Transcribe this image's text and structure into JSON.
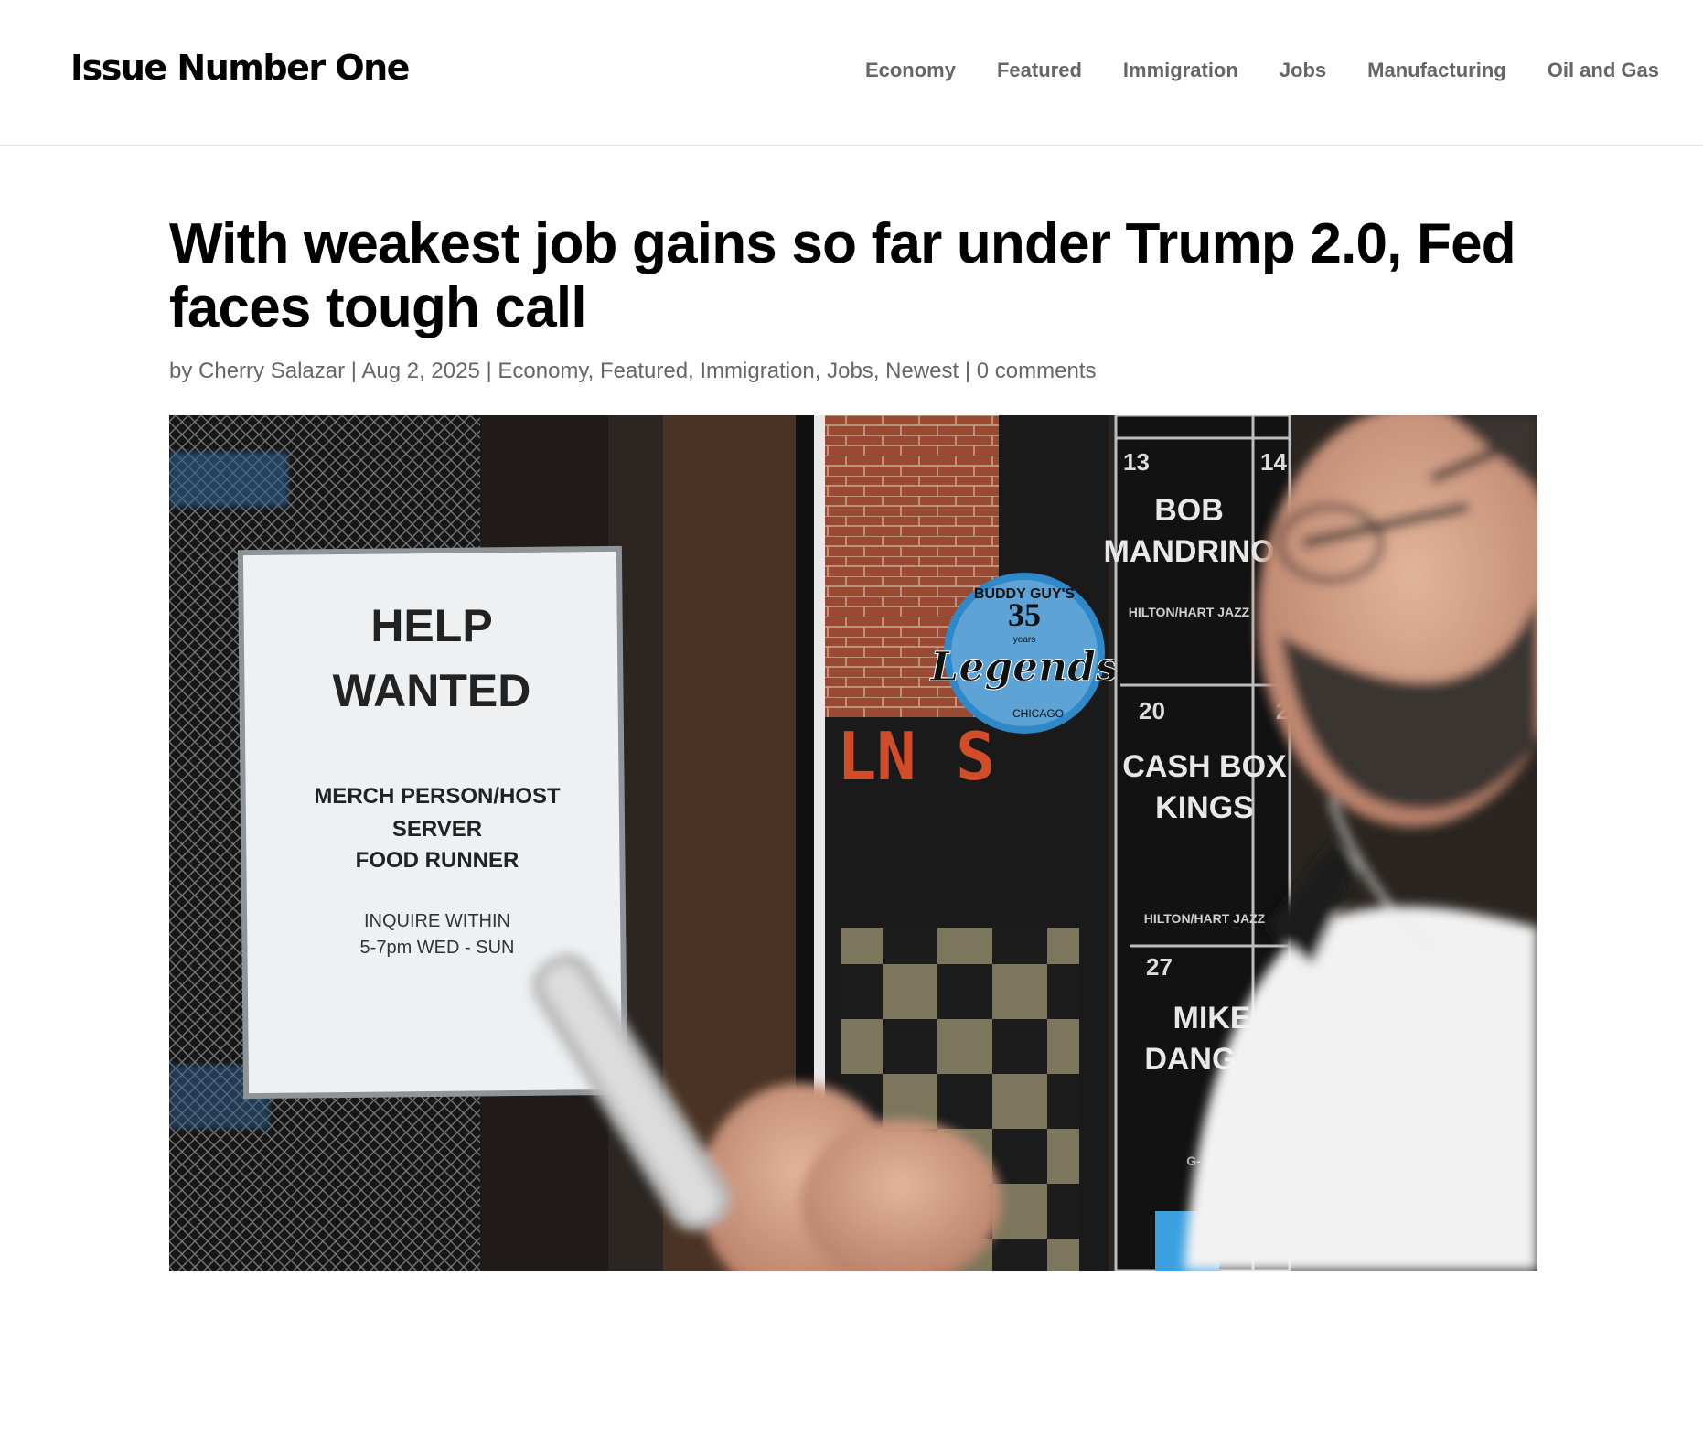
{
  "site": {
    "name": "Issue Number One"
  },
  "nav": {
    "items": [
      "Economy",
      "Featured",
      "Immigration",
      "Jobs",
      "Manufacturing",
      "Oil and Gas"
    ]
  },
  "article": {
    "title": "With weakest job gains so far under Trump 2.0, Fed faces tough call",
    "meta": {
      "by": "by",
      "author": "Cherry Salazar",
      "separator": "|",
      "date": "Aug 2, 2025",
      "categories": [
        "Economy",
        "Featured",
        "Immigration",
        "Jobs",
        "Newest"
      ],
      "comments": "0 comments"
    },
    "hero_image": {
      "sign": {
        "line1": "HELP",
        "line2": "WANTED",
        "positions": [
          "MERCH PERSON/HOST",
          "SERVER",
          "FOOD RUNNER"
        ],
        "inquire": "INQUIRE WITHIN",
        "hours": "5-7pm WED - SUN"
      },
      "sticker": {
        "top": "BUDDY GUY'S",
        "number": "35",
        "sub": "years",
        "script": "Legends",
        "city": "CHICAGO"
      },
      "neon": "LN S",
      "calendar": [
        {
          "day": "13",
          "name1": "BOB",
          "name2": "MANDRINO",
          "venue": "HILTON/HART JAZZ"
        },
        {
          "day": "14"
        },
        {
          "day": "20",
          "name1": "CASH BOX",
          "name2": "KINGS",
          "venue": "HILTON/HART JAZZ"
        },
        {
          "day": "21"
        },
        {
          "day": "27",
          "name1": "MIKE",
          "name2": "DANGER",
          "venue": "G-"
        }
      ]
    }
  },
  "colors": {
    "nav_text": "#666666",
    "meta_text": "#666666",
    "title_text": "#000000",
    "divider": "#e6e6e6"
  }
}
